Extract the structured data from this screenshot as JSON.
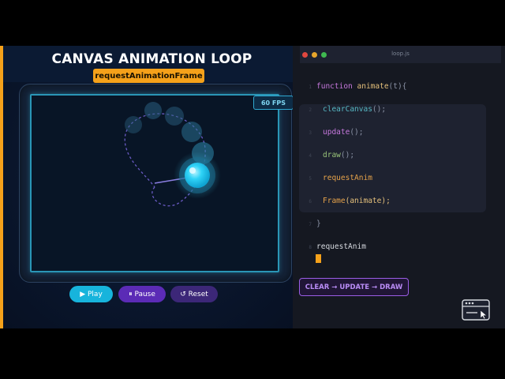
{
  "header": {
    "title": "CANVAS ANIMATION LOOP",
    "subtitle": "requestAnimationFrame"
  },
  "canvas": {
    "fps_label": "60 FPS"
  },
  "controls": {
    "play_label": "▶ Play",
    "pause_label": "⏸ Pause",
    "reset_label": "↺ Reset"
  },
  "editor": {
    "file_name": "loop.js",
    "cycle_label": "CLEAR → UPDATE → DRAW",
    "line_numbers": [
      "1",
      "2",
      "3",
      "4",
      "5",
      "6",
      "7",
      "8"
    ],
    "line1": {
      "keyword": "function",
      "name": "animate",
      "params": "(t){"
    },
    "calls": [
      {
        "name": "clearCanvas",
        "args": "();"
      },
      {
        "name": "update",
        "args": "();"
      },
      {
        "name": "draw",
        "args": "();"
      },
      {
        "name": "requestAnim",
        "args": ""
      },
      {
        "name": "Frame",
        "args": "(animate);"
      }
    ],
    "closing": "}",
    "trailing": "requestAnim"
  },
  "colors": {
    "accent_orange": "#f5a11a",
    "accent_cyan": "#17b4dc",
    "accent_purple": "#5b2bb6",
    "editor_bg": "#151821"
  },
  "icons": {
    "play": "play-icon",
    "pause": "pause-icon",
    "reset": "reset-icon",
    "browser": "browser-window-icon",
    "cursor": "mouse-pointer-icon"
  }
}
